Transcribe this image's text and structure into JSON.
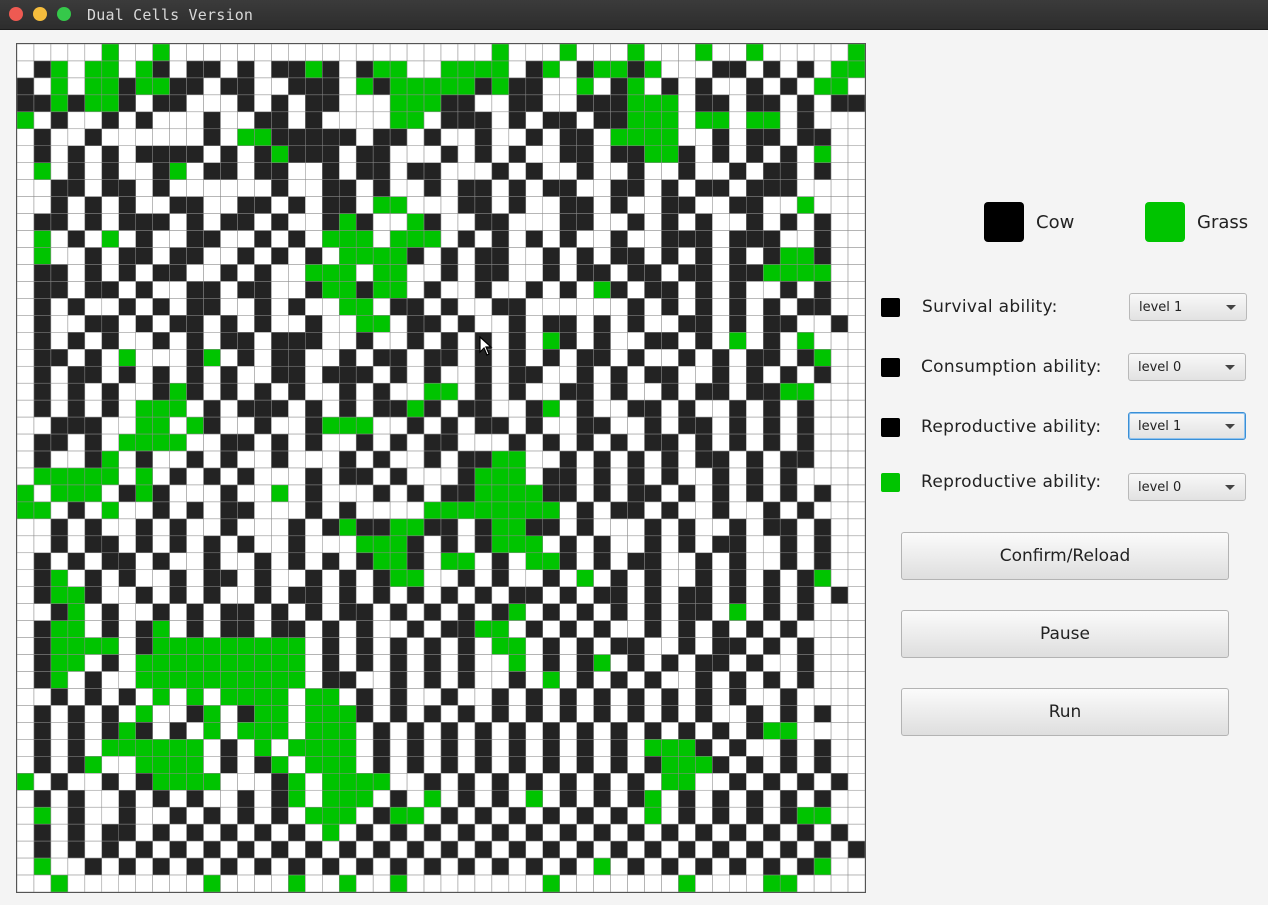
{
  "window": {
    "title": "Dual Cells Version"
  },
  "colors": {
    "cow": "#000000",
    "grass": "#00c400",
    "dead": "#ffffff",
    "focus": "#3a8fd6"
  },
  "legend": {
    "cow_label": "Cow",
    "grass_label": "Grass"
  },
  "settings": [
    {
      "species": "cow",
      "label": "Survival ability:",
      "value": "level 1",
      "focused": false
    },
    {
      "species": "cow",
      "label": "Consumption ability:",
      "value": "level 0",
      "focused": false
    },
    {
      "species": "cow",
      "label": "Reproductive ability:",
      "value": "level 1",
      "focused": true
    },
    {
      "species": "grass",
      "label": "Reproductive ability:",
      "value": "level 0",
      "focused": false
    }
  ],
  "buttons": {
    "confirm": "Confirm/Reload",
    "pause": "Pause",
    "run": "Run"
  },
  "grid": {
    "rows": 50,
    "cols": 50,
    "cells": [
      "00000G00G0000000000000000000G000G000G000G00G00000G0G",
      "01G0GG0G101101011G101GG00GGGG01G01GG1G0001101010GG",
      "10G0GG1GG11011001110G1GGGGG1G1100G01G0101001010GG",
      "11G1GG1011000101011000GGG11001100111GGG01101101011",
      "G010010100010011010000GG011101011011GGG0GG0GG0100",
      "0100100000010GG11111011010010010110GGGG0010110110",
      "010101011110101G111011000101010011011GG10101010G0",
      "0G0101001G011011001011011000101001001001001011010",
      "001101101000000100110100101101011001101011011100",
      "001010100110011010110GG00011010011010011001100G0",
      "0110101110101101001G100G1001100011001010100101010",
      "0G010G010011001010GGG0GGG010101010010011101110010",
      "0G00101101100101010GGGG1010110010101101010101GG10",
      "01101010110010100GGG0GG001011001011011011011GGGG0",
      "011011010011011001GG1GG01001001010G10110101001010",
      "0101001010110010100GG011010011000000101010101011",
      "01001101011010100100GG011010010110101001101011001",
      "0101010010101101110010010101010G1010011010G010G",
      "011010G0001G01011001011011010101011010010101101G",
      "0101101010101001101110101001011001010110010101010",
      "010101001G10101010010100GG0101001101001011011GG0",
      "0101010GGG0101110101011G1011001G010011010010101",
      "0011100GG0G1001001GGG00101011010011001011010101",
      "011010GGGG0011010100101011000101010101101010101",
      "01001G0100101001000101001011GG001010101011010110",
      "0GGGGG0G0101010001011010001GGG01101010100101010",
      "G0GGG01G1000100G01000101011GGGG11010110101010101",
      "GG010G001010110001010000GGGGGGGG01011010010010100",
      "0010100101001000101G11GG1101GG1101000101001011010",
      "00101101010101001000GGG10101GGG010100101011001010",
      "010101101001001010101GG10GG010GG10101100101001010",
      "01G0101001011010010101GG001010010G0101001010101G0",
      "01GG1001010100101101010101010110101101011010101010",
      "001G0100101011010101101010101G010101010110G01010",
      "01GG0101G010110110101001011GG010101001010101010",
      "01GGGG01GGGGGGGGG01010101010GG010101100101101010",
      "01GG010GGGGGGGGGG010101010100G0101G0101011010010",
      "01G0100GGGGGGGGGG01100101010010G010101001010101",
      "00101010G0G0GGGG0GG0101001001010101010101010010",
      "0101010G001G01GG0GGG10101010101010101010100101010",
      "010101G1010G0GGG0GGG010101010101010101010101GG0",
      "01010GGGGGG010G0GGGG01010101010101010GGG101001010",
      "0101G00GGGG0101G0GGG010101010101010101GGG1010101",
      "G0100101GGGG0001G0GGGG0010101010101010GG001010101",
      "0101001010100101G0GGG010G01010G010101G0101010101",
      "0G010010010101010GGG01GG0101010101010G01010101GG",
      "010101101010101010G0101010101010101010101010101010",
      "01010101010101010101010101010101010101010101010101",
      "0G00101010101010101010101010101010G010101010101G",
      "00G00000000G0000G00G00G00000000G0000000G0000GG000"
    ]
  }
}
